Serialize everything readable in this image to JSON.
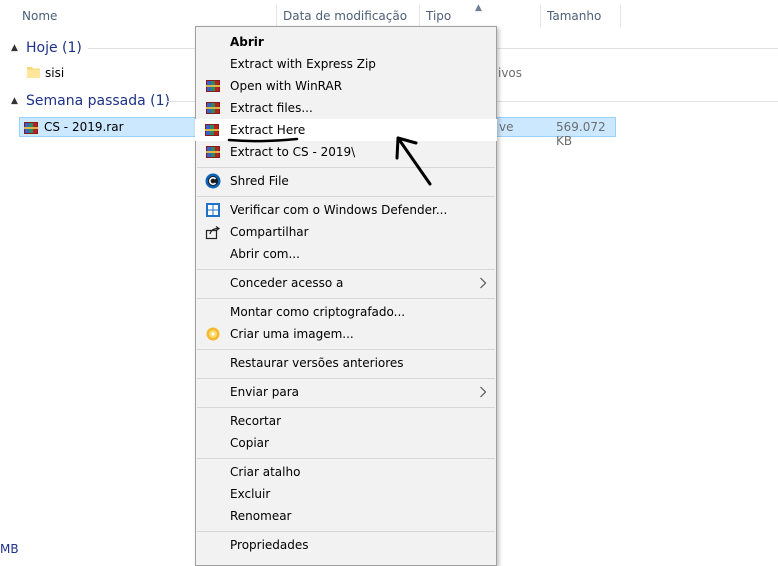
{
  "columns": {
    "name": "Nome",
    "date_modified": "Data de modificação",
    "type": "Tipo",
    "size": "Tamanho"
  },
  "groups": [
    {
      "title": "Hoje (1)",
      "items": [
        {
          "name": "sisi",
          "icon": "folder-icon",
          "type_fragment": "ivos"
        }
      ]
    },
    {
      "title": "Semana passada (1)",
      "items": [
        {
          "name": "CS - 2019.rar",
          "icon": "winrar-archive-icon",
          "type_fragment": "ve",
          "size": "569.072 KB",
          "selected": true
        }
      ]
    }
  ],
  "status_bar": {
    "fragment": "MB"
  },
  "context_menu": {
    "items": [
      {
        "label": "Abrir",
        "bold": true,
        "icon": ""
      },
      {
        "label": "Extract with Express Zip",
        "icon": ""
      },
      {
        "label": "Open with WinRAR",
        "icon": "winrar-icon"
      },
      {
        "label": "Extract files...",
        "icon": "winrar-icon"
      },
      {
        "label": "Extract Here",
        "icon": "winrar-icon",
        "highlighted": true
      },
      {
        "label": "Extract to CS - 2019\\",
        "icon": "winrar-icon"
      },
      {
        "label": "Shred File",
        "icon": "shred-icon"
      },
      {
        "label": "Verificar com o Windows Defender...",
        "icon": "defender-shield-icon"
      },
      {
        "label": "Compartilhar",
        "icon": "share-icon"
      },
      {
        "label": "Abrir com...",
        "icon": ""
      },
      {
        "label": "Conceder acesso a",
        "icon": "",
        "submenu": true
      },
      {
        "label": "Montar como criptografado...",
        "icon": ""
      },
      {
        "label": "Criar uma imagem...",
        "icon": "disc-image-icon"
      },
      {
        "label": "Restaurar versões anteriores",
        "icon": ""
      },
      {
        "label": "Enviar para",
        "icon": "",
        "submenu": true
      },
      {
        "label": "Recortar",
        "icon": ""
      },
      {
        "label": "Copiar",
        "icon": ""
      },
      {
        "label": "Criar atalho",
        "icon": ""
      },
      {
        "label": "Excluir",
        "icon": ""
      },
      {
        "label": "Renomear",
        "icon": ""
      },
      {
        "label": "Propriedades",
        "icon": ""
      }
    ]
  },
  "colors": {
    "selection_bg": "#cce8ff",
    "menu_bg": "#f2f2f2",
    "group_title": "#1e3287"
  }
}
